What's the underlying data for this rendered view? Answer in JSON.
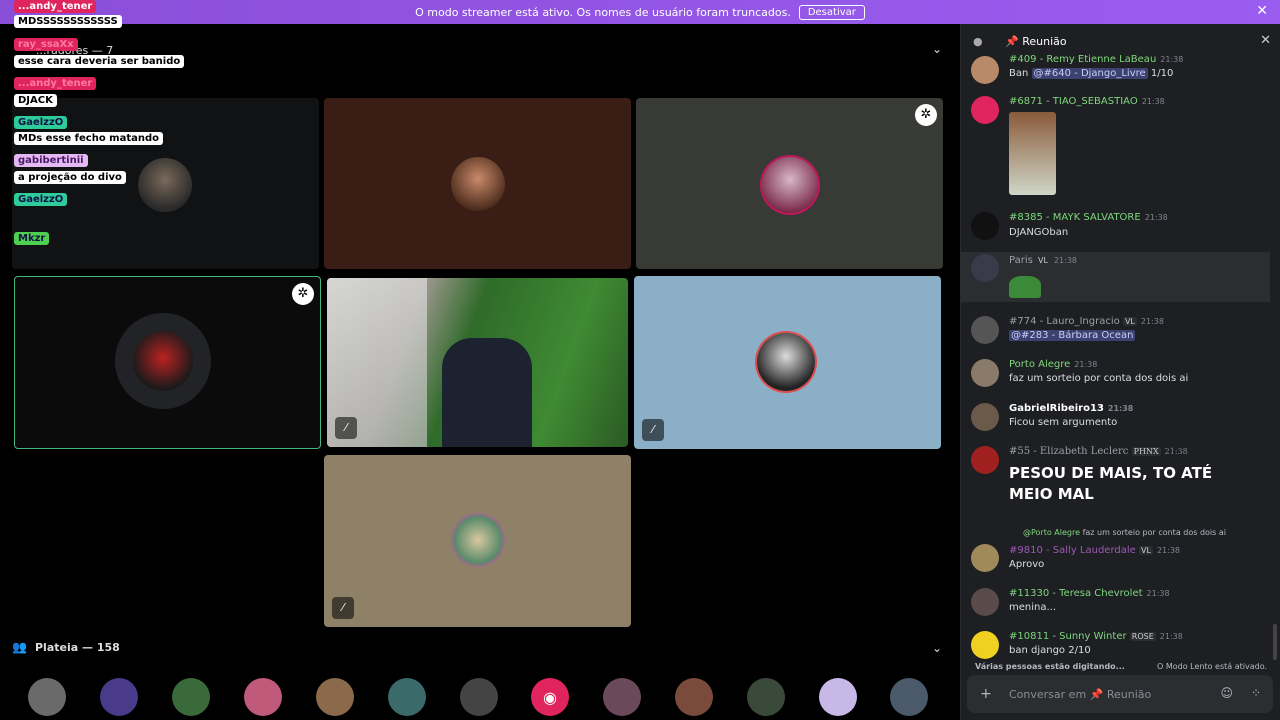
{
  "banner": {
    "text": "O modo streamer está ativo. Os nomes de usuário foram truncados.",
    "button": "Desativar",
    "close": "✕"
  },
  "stage": {
    "section_label": "...radores — 7",
    "tiles_icons": {
      "gear": "gear-icon",
      "mute": "mic-muted-icon"
    }
  },
  "overlay_chat": [
    {
      "kind": "name",
      "text": "...andy_tener",
      "color": "#e0245e"
    },
    {
      "kind": "msg",
      "text": "MDSSSSSSSSSSSS"
    },
    {
      "kind": "name",
      "text": "ray_ssaXx",
      "color": "#e0245e"
    },
    {
      "kind": "msg",
      "text": "esse cara deveria ser banido"
    },
    {
      "kind": "name",
      "text": "...andy_tener",
      "color": "#e0245e"
    },
    {
      "kind": "msg",
      "text": "DJACK"
    },
    {
      "kind": "name",
      "text": "GaelzzO",
      "color": "#2ecc9a"
    },
    {
      "kind": "msg",
      "text": "MDs esse fecho matando"
    },
    {
      "kind": "name",
      "text": "gabibertinii",
      "color": "#c88df0"
    },
    {
      "kind": "msg",
      "text": "a projeção do divo"
    },
    {
      "kind": "name",
      "text": "GaelzzO",
      "color": "#2ecc9a"
    },
    {
      "kind": "name",
      "text": "Mkzr",
      "color": "#4fcf4f"
    }
  ],
  "audience": {
    "label": "Plateia — 158"
  },
  "panel": {
    "title": "Reunião",
    "messages": [
      {
        "name": "#409 - Remy Etienne LaBeau",
        "time": "21:38",
        "text_pre": "Ban ",
        "mention": "@#640 - Django_Livre",
        "text_post": " 1/10",
        "color": "#7dd87d"
      },
      {
        "name": "#6871 - TIAO_SEBASTIAO",
        "time": "21:38",
        "text": "",
        "color": "#7dd87d"
      },
      {
        "name": "#8385 - MAYK SALVATORE",
        "time": "21:38",
        "text": "DJANGOban",
        "color": "#7dd87d"
      },
      {
        "name": "Paris",
        "tag": "VL",
        "time": "21:38",
        "text": "",
        "color": "#9aa0a6"
      },
      {
        "name": "#774 - Lauro_Ingracio",
        "tag": "VL",
        "time": "21:38",
        "mention": "@#283 - Bárbara Ocean",
        "color": "#9aa0a6"
      },
      {
        "name": "Porto Alegre",
        "time": "21:38",
        "text": "faz um sorteio por conta dos dois ai",
        "color": "#7dd87d"
      },
      {
        "name": "GabrielRibeiro13",
        "time": "21:38",
        "text": "Ficou sem argumento",
        "color": "#ffffff"
      },
      {
        "name": "#55 - Elizabeth Leclerc",
        "tag": "PHNX",
        "time": "21:38",
        "text": "PESOU DE MAIS, TO ATÉ MEIO MAL",
        "color": "#9aa0a6"
      },
      {
        "reply": "@Porto Alegre",
        "reply_text": "faz um sorteio por conta dos dois ai",
        "name": "#9810 - Sally Lauderdale",
        "tag": "VL",
        "time": "21:38",
        "text": "Aprovo",
        "color": "#9b59b6"
      },
      {
        "name": "#11330 - Teresa Chevrolet",
        "time": "21:38",
        "text": "menina...",
        "color": "#7dd87d"
      },
      {
        "name": "#10811 - Sunny Winter",
        "tag": "ROSE",
        "time": "21:38",
        "text": "ban django 2/10",
        "color": "#7dd87d"
      }
    ],
    "typing": "Várias pessoas estão digitando...",
    "slowmode": "O Modo Lento está ativado.",
    "composer_placeholder": "Conversar em 📌 Reunião"
  },
  "colors": {
    "accent": "#5865f2",
    "banner": "#9b5cf0",
    "speaking": "#43b581"
  }
}
